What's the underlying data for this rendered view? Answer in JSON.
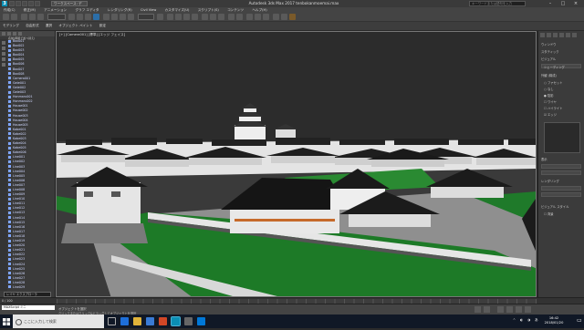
{
  "titlebar": {
    "app_title": "Autodesk 3ds Max 2017   tenbokanmoemai.max",
    "workspace_label": "ワークスペース: デ",
    "search_placeholder": "キーワードまたは語句を入力",
    "logo_letter": "3"
  },
  "menubar": {
    "items": [
      "作成(C)",
      "修正(M)",
      "アニメーション",
      "グラフ エディタ",
      "レンダリング(R)",
      "Civil View",
      "カスタマイズ(U)",
      "スクリプト(S)",
      "コンテンツ",
      "ヘルプ(H)"
    ]
  },
  "ribbon": {
    "items": [
      "モデリング",
      "自由形式",
      "選択",
      "オブジェクト ペイント",
      "設定"
    ]
  },
  "viewport": {
    "label": "[+] [Camera001] [標準] [エッジ フェイス]"
  },
  "explorer": {
    "header": "名前(昇順で並べ替え)",
    "items": [
      "Box001",
      "Box002",
      "Box003",
      "Box004",
      "Box005",
      "Box006",
      "Box007",
      "Box008",
      "Camera001",
      "Gate001",
      "Gate002",
      "Gate003",
      "Honmaru001",
      "Honmaru002",
      "House001",
      "House002",
      "House003",
      "House004",
      "House005",
      "Kabe001",
      "Kabe002",
      "Kabe003",
      "Kabe004",
      "Kabe005",
      "Kabe006",
      "Line001",
      "Line002",
      "Line003",
      "Line004",
      "Line005",
      "Line006",
      "Line007",
      "Line008",
      "Line009",
      "Line010",
      "Line011",
      "Line012",
      "Line013",
      "Line014",
      "Line015",
      "Line016",
      "Line017",
      "Line018",
      "Line019",
      "Line020",
      "Line021",
      "Line022",
      "Line023",
      "Line024",
      "Line025",
      "Line026",
      "Line027",
      "Line028",
      "Line029",
      "Line030",
      "Line031"
    ],
    "layer_field": "レイヤ エクスプローラ"
  },
  "cmdpanel": {
    "sections": [
      "ウィンドウ",
      "スタティック",
      "ビジュアル",
      "シェーディング",
      "表示",
      "レンダリング",
      "ビジュアル スタイル"
    ],
    "rollout_title": "外観 (構成)",
    "options": [
      "ファセット",
      "なし",
      "陰影",
      "ワイヤ",
      "ハイライト",
      "エッジ",
      "背景"
    ]
  },
  "status": {
    "maxscript_label": "MAXScript ミニ",
    "selection_text": "オブジェクトを選択",
    "hint_text": "クリックまたはクリック&ドラッグしてオブジェクトを選択",
    "frame_counter": "0 / 100"
  },
  "taskbar": {
    "search_placeholder": "ここに入力して検索",
    "time": "16:42",
    "date": "2018/01/20",
    "ime": "あ"
  },
  "colors": {
    "sky": "#2c2c2c",
    "grass": "#1f7a2a",
    "roof": "#1b1b1b",
    "wall": "#d8d8d8",
    "taskbar": "#101826",
    "accent": "#0b8fb5"
  }
}
